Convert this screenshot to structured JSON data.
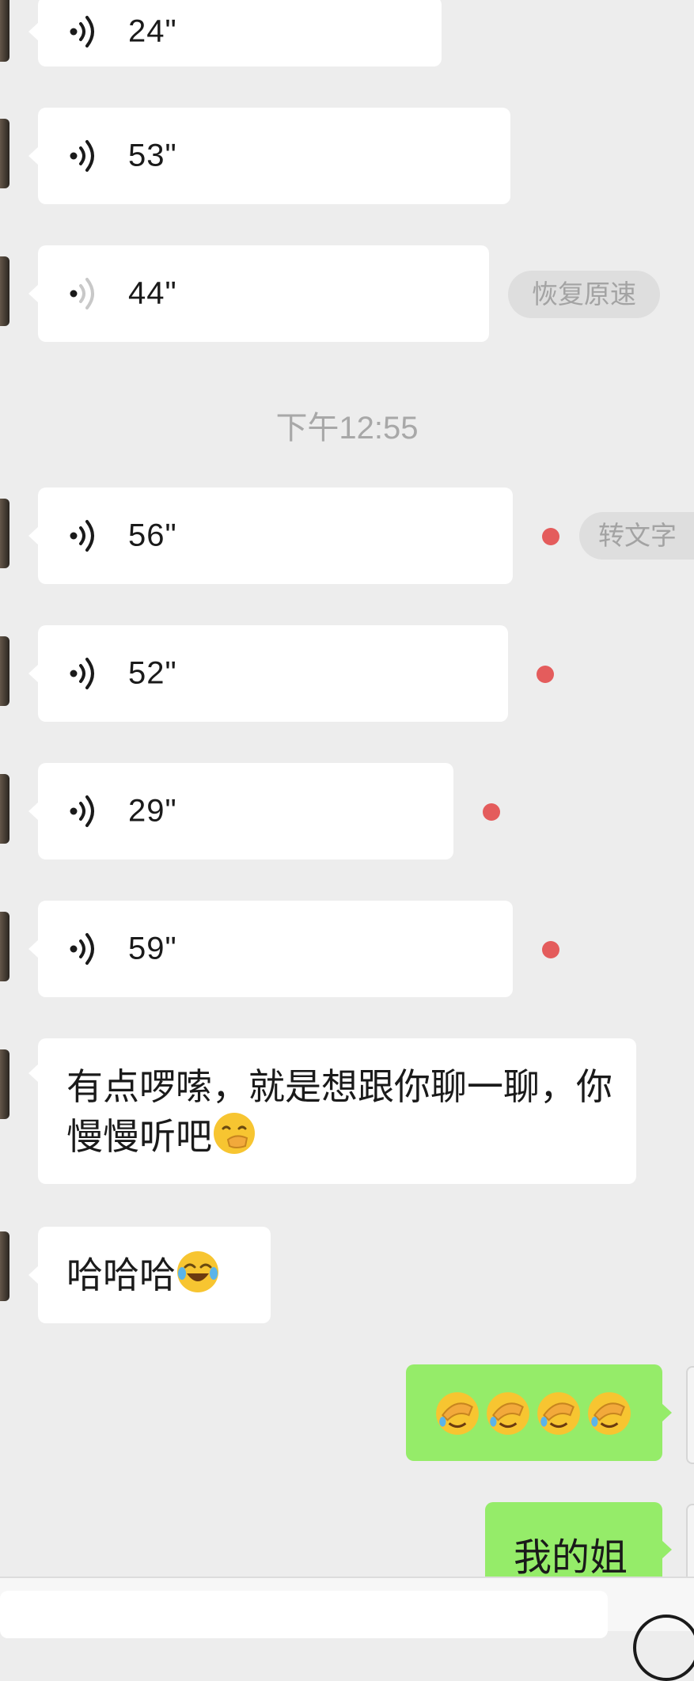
{
  "chat": {
    "voice_messages_top": [
      {
        "duration": "24\""
      },
      {
        "duration": "53\""
      },
      {
        "duration": "44\""
      }
    ],
    "restore_speed_label": "恢复原速",
    "timestamp": "下午12:55",
    "voice_messages_bottom": [
      {
        "duration": "56\""
      },
      {
        "duration": "52\""
      },
      {
        "duration": "29\""
      },
      {
        "duration": "59\""
      }
    ],
    "to_text_label": "转文字",
    "text_message_1": "有点啰嗦，就是想跟你聊一聊，你慢慢听吧",
    "text_message_1_emoji": "hand-over-mouth-emoji",
    "text_message_2": "哈哈哈",
    "text_message_2_emoji": "tears-of-joy-emoji",
    "outgoing_emoji_message": "facepalm-emoji x4",
    "outgoing_text_message": "我的姐"
  },
  "colors": {
    "background": "#ededed",
    "incoming_bubble": "#ffffff",
    "outgoing_bubble": "#95ec69",
    "unread_dot": "#e45c5c",
    "timestamp_text": "#a8a8a8"
  },
  "icons": {
    "voice": "voice-wave-icon",
    "unread": "unread-dot-icon"
  }
}
